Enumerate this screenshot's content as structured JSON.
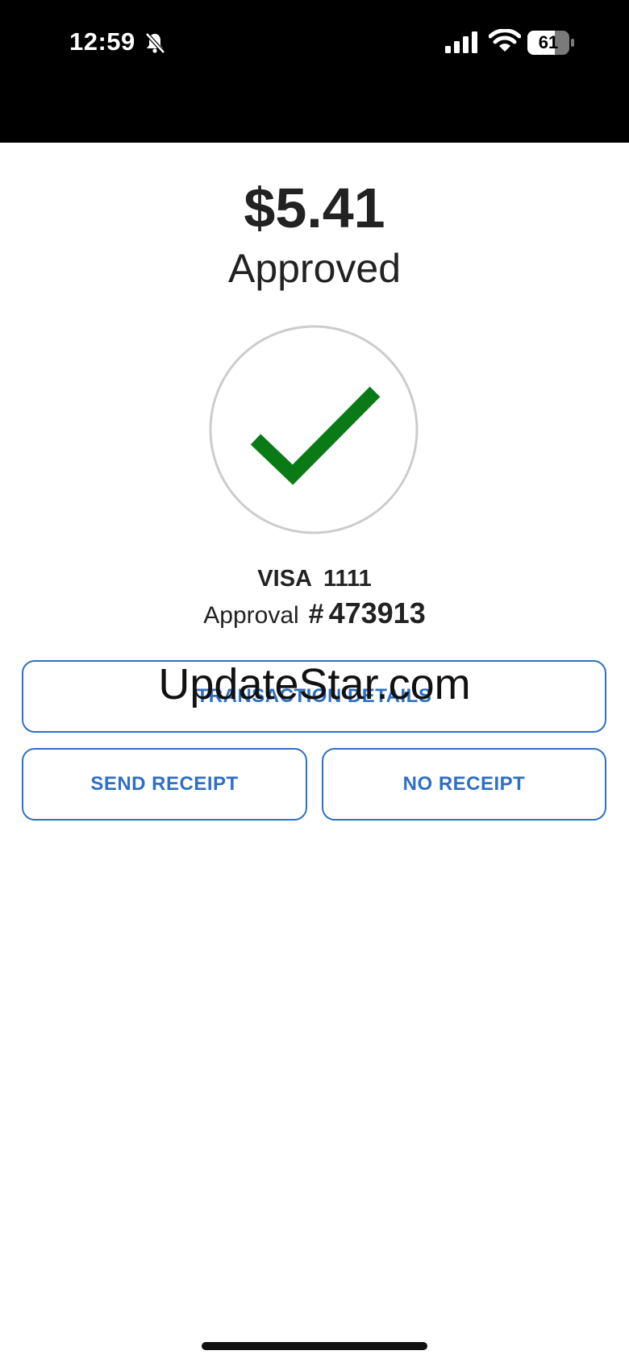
{
  "status_bar": {
    "time": "12:59",
    "battery_level": "61",
    "icons": [
      "bell-off-icon",
      "signal-icon",
      "wifi-icon",
      "battery-icon"
    ]
  },
  "transaction": {
    "amount": "$5.41",
    "status": "Approved",
    "card_brand": "VISA",
    "card_last4": "1111",
    "approval_label": "Approval",
    "approval_hash": "#",
    "approval_number": "473913"
  },
  "buttons": {
    "details": "TRANSACTION DETAILS",
    "send_receipt": "SEND RECEIPT",
    "no_receipt": "NO RECEIPT"
  },
  "watermark": "UpdateStar.com",
  "colors": {
    "accent": "#2f6fc4",
    "success": "#0a7a17",
    "text": "#222222"
  }
}
